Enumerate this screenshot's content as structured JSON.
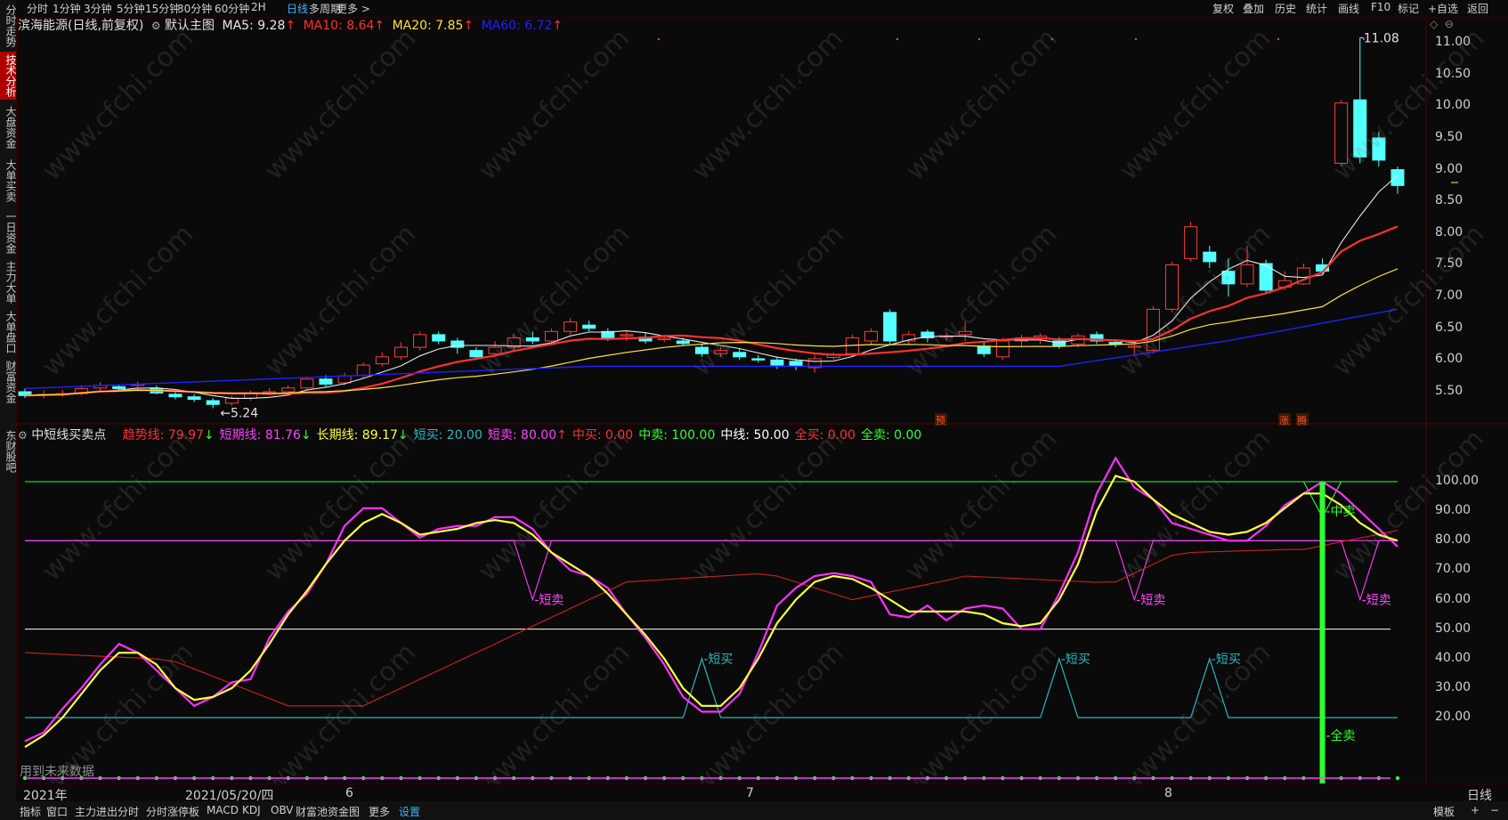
{
  "left_tabs": [
    "分时走势",
    "技术分析",
    "大盘资金",
    "大单买卖",
    "一日资金",
    "主力大单",
    "大单盘口",
    "财富资金",
    "东财股吧"
  ],
  "left_tabs_active": 1,
  "toolbar": {
    "periods": [
      "分时",
      "1分钟",
      "3分钟",
      "5分钟",
      "15分钟",
      "30分钟",
      "60分钟",
      "2H",
      "日线",
      "多周期",
      "更多 >"
    ],
    "active_period": "日线",
    "right_items": [
      "复权",
      "叠加",
      "历史",
      "统计",
      "画线",
      "F10",
      "标记",
      "+自选",
      "返回"
    ]
  },
  "main_panel": {
    "stock_name": "滨海能源(日线,前复权)",
    "template_label": "默认主图",
    "ma5": {
      "label": "MA5: 9.28",
      "color": "#e8e8e8"
    },
    "ma10": {
      "label": "MA10: 8.64",
      "color": "#ff3030"
    },
    "ma20": {
      "label": "MA20: 7.85",
      "color": "#ffe040"
    },
    "ma60": {
      "label": "MA60: 6.72",
      "color": "#2020ff"
    },
    "arrow_up": "↑",
    "y_ticks": [
      "11.00",
      "10.50",
      "10.00",
      "9.50",
      "9.00",
      "8.50",
      "8.00",
      "7.50",
      "7.00",
      "6.50",
      "6.00",
      "5.50"
    ],
    "high_label": "11.08",
    "low_label": "5.24",
    "badges": [
      "预",
      "涨",
      "腾"
    ],
    "up_color": "#ff3c3c",
    "down_color": "#54ffff"
  },
  "indicator_panel": {
    "name": "中短线买卖点",
    "values": [
      {
        "label": "趋势线: 79.97",
        "arrow": "↓",
        "color": "#ff3030"
      },
      {
        "label": "短期线: 81.76",
        "arrow": "↓",
        "color": "#ff40ff"
      },
      {
        "label": "长期线: 89.17",
        "arrow": "↓",
        "color": "#ffff40"
      },
      {
        "label": "短买: 20.00",
        "arrow": "",
        "color": "#2ab7c0"
      },
      {
        "label": "短卖: 80.00",
        "arrow": "↑",
        "color": "#ff40ff"
      },
      {
        "label": "中买: 0.00",
        "arrow": "",
        "color": "#ff3030"
      },
      {
        "label": "中卖: 100.00",
        "arrow": "",
        "color": "#30ff30"
      },
      {
        "label": "中线: 50.00",
        "arrow": "",
        "color": "#ffffff"
      },
      {
        "label": "全买: 0.00",
        "arrow": "",
        "color": "#ff3030"
      },
      {
        "label": "全卖: 0.00",
        "arrow": "",
        "color": "#30ff30"
      }
    ],
    "y_ticks": [
      "100.00",
      "90.00",
      "80.00",
      "70.00",
      "60.00",
      "50.00",
      "40.00",
      "30.00",
      "20.00"
    ],
    "signal_labels": {
      "short_sell": "短卖",
      "short_buy": "短买",
      "mid_sell": "中卖",
      "all_sell": "全卖"
    },
    "note": "用到未来数据"
  },
  "date_axis": {
    "labels": [
      "2021年",
      "2021/05/20/四",
      "6",
      "7",
      "8"
    ],
    "period_label": "日线"
  },
  "bottom_bar": {
    "items": [
      "指标",
      "窗口",
      "主力进出分时",
      "分时涨停板",
      "MACD",
      "KDJ",
      "OBV",
      "财富池资金图",
      "更多",
      "设置"
    ],
    "active": "设置",
    "right_items": [
      "模板",
      "+",
      "−"
    ]
  },
  "watermark": "www.cfchi.com"
}
